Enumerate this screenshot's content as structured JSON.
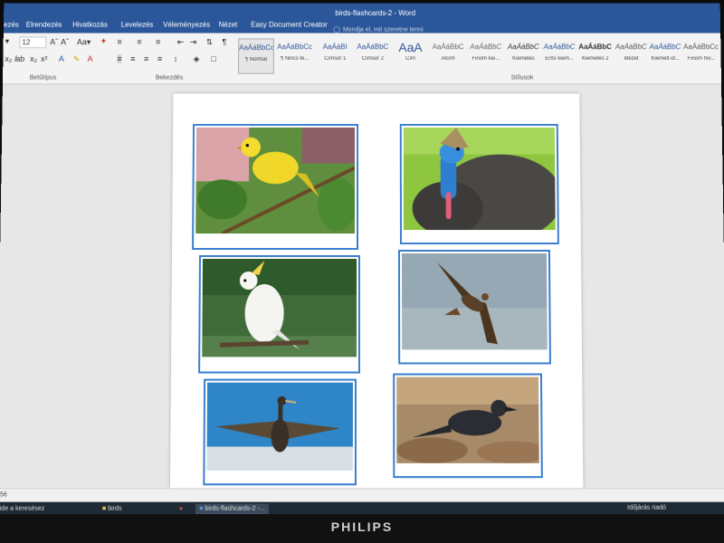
{
  "window": {
    "title": "birds-flashcards-2 - Word",
    "tabs": [
      "ezés",
      "Elrendezés",
      "Hivatkozás",
      "Levelezés",
      "Véleményezés",
      "Nézet",
      "Easy Document Creator"
    ],
    "search_hint": "Mondja el, mit szeretne tenni"
  },
  "ribbon": {
    "font_size": "12",
    "group_font": "Betűtípus",
    "group_paragraph": "Bekezdés",
    "group_styles": "Stílusok",
    "styles": [
      {
        "sample": "AaÁáBbCc",
        "name": "¶ Normál"
      },
      {
        "sample": "AaÁáBbCc",
        "name": "¶ Nincs té..."
      },
      {
        "sample": "AaÁáBI",
        "name": "Címsor 1"
      },
      {
        "sample": "AaÁáBbC",
        "name": "Címsor 2"
      },
      {
        "sample": "AaA",
        "name": "Cím"
      },
      {
        "sample": "AaÁáBbC",
        "name": "Alcím"
      },
      {
        "sample": "AaÁáBbC",
        "name": "Finom kie..."
      },
      {
        "sample": "AaÁáBbC",
        "name": "Kiemelés"
      },
      {
        "sample": "AaÁáBbC",
        "name": "Erős kiem..."
      },
      {
        "sample": "AaÁáBbC",
        "name": "Kiemelés 2"
      },
      {
        "sample": "AaÁáBbC",
        "name": "Idézet"
      },
      {
        "sample": "AaÁáBbC",
        "name": "Kiemelt id..."
      },
      {
        "sample": "AaÁáBbCc",
        "name": "Finom hiv..."
      }
    ]
  },
  "document": {
    "cards": [
      {
        "subject": "yellow canary on branch"
      },
      {
        "subject": "cassowary"
      },
      {
        "subject": "white cockatoo"
      },
      {
        "subject": "bird of prey in flight"
      },
      {
        "subject": "cormorant with spread wings"
      },
      {
        "subject": "crow on leaves"
      }
    ]
  },
  "statusbar": {
    "left": "56"
  },
  "taskbar": {
    "items": [
      {
        "label": "ide a keresésez"
      },
      {
        "label": "birds"
      },
      {
        "label": "birds-flashcards-2 -..."
      }
    ],
    "tray": "Időjárás riadó"
  },
  "monitor": {
    "brand": "PHILIPS"
  },
  "colors": {
    "word_blue": "#2b579a",
    "card_border": "#3a7fcf"
  }
}
